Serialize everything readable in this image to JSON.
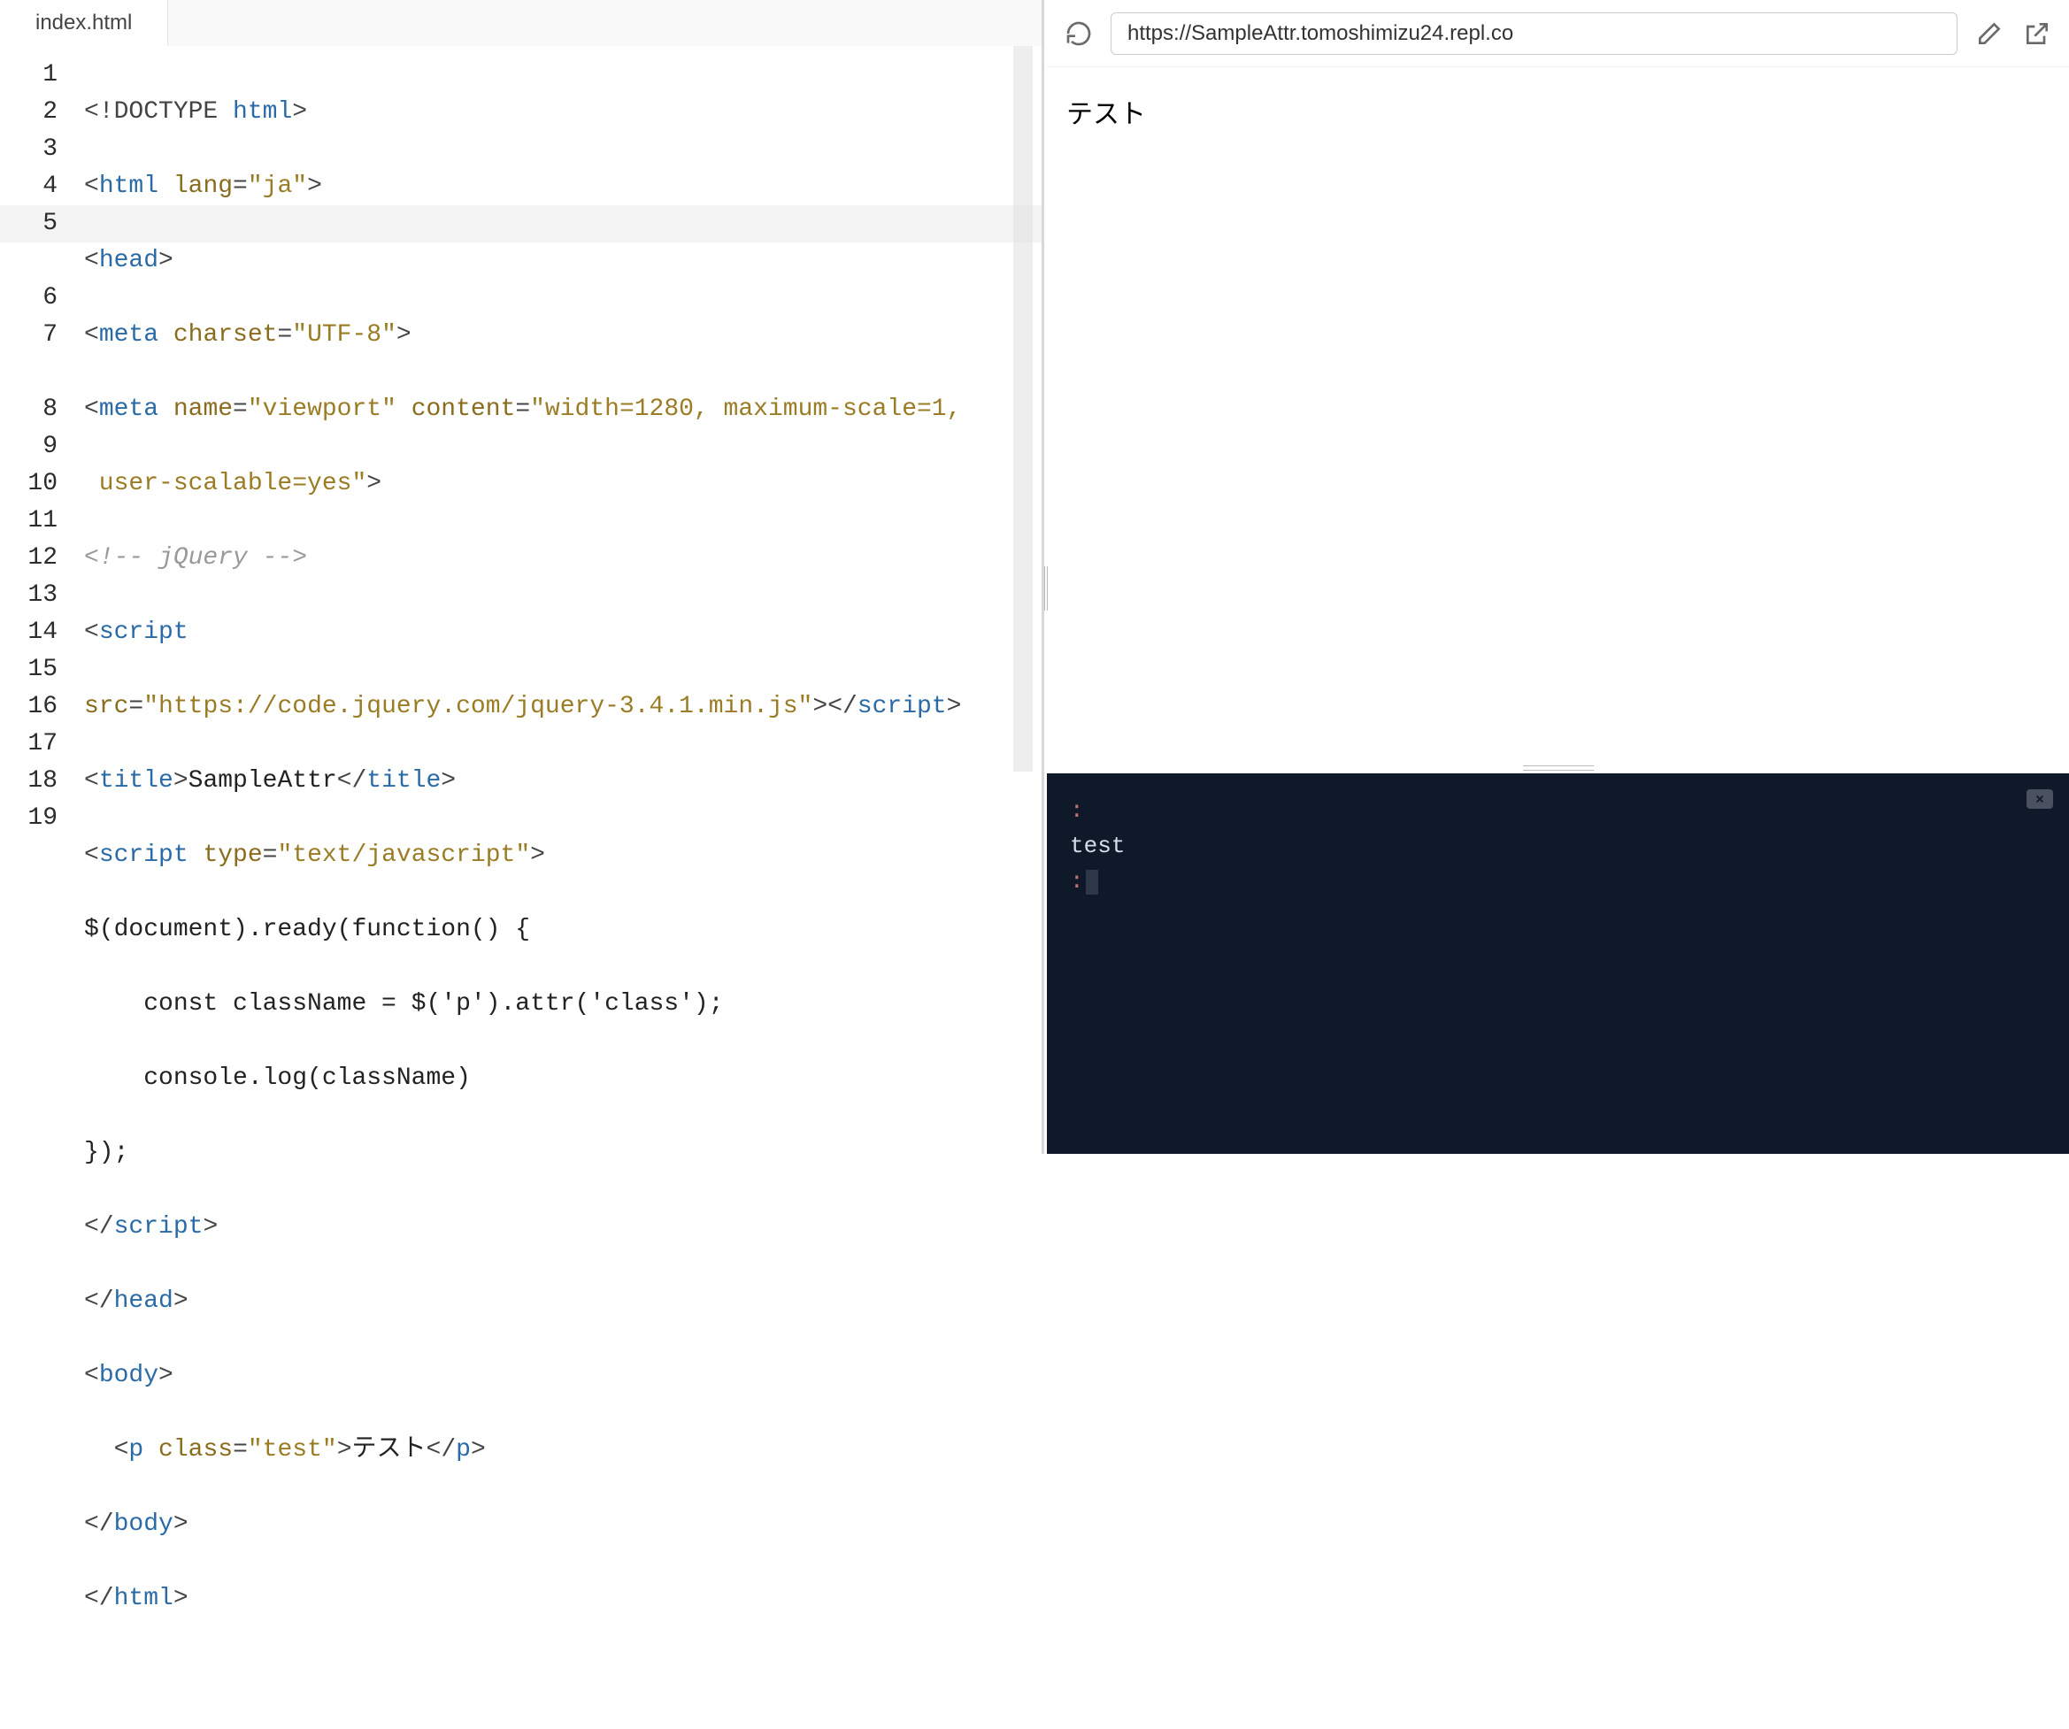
{
  "tab": {
    "filename": "index.html"
  },
  "editor": {
    "lineNumbers": [
      "1",
      "2",
      "3",
      "4",
      "5",
      "6",
      "7",
      "8",
      "9",
      "10",
      "11",
      "12",
      "13",
      "14",
      "15",
      "16",
      "17",
      "18",
      "19"
    ],
    "highlightedLine": 5,
    "code": {
      "l1": {
        "pre": "<!DOCTYPE ",
        "tag": "html",
        "post": ">"
      },
      "l2": {
        "open": "<",
        "tag": "html",
        "attrn": " lang",
        "eq": "=",
        "attrv": "\"ja\"",
        "close": ">"
      },
      "l3": {
        "open": "<",
        "tag": "head",
        "close": ">"
      },
      "l4": {
        "open": "<",
        "tag": "meta",
        "attrn": " charset",
        "eq": "=",
        "attrv": "\"UTF-8\"",
        "close": ">"
      },
      "l5": {
        "open": "<",
        "tag": "meta",
        "attrn1": " name",
        "eq1": "=",
        "attrv1": "\"viewport\"",
        "attrn2": " content",
        "eq2": "=",
        "attrv2": "\"width=1280, maximum-scale=1,"
      },
      "l5b": {
        "cont": " user-scalable=yes\"",
        "close": ">"
      },
      "l6": {
        "comment": "<!-- jQuery -->"
      },
      "l7": {
        "open": "<",
        "tag": "script"
      },
      "l7b": {
        "attrn": "src",
        "eq": "=",
        "attrv": "\"https://code.jquery.com/jquery-3.4.1.min.js\"",
        "close": ">",
        "open2": "</",
        "tag2": "script",
        "close2": ">"
      },
      "l8": {
        "open": "<",
        "tag": "title",
        "close": ">",
        "text": "SampleAttr",
        "open2": "</",
        "tag2": "title",
        "close2": ">"
      },
      "l9": {
        "open": "<",
        "tag": "script",
        "attrn": " type",
        "eq": "=",
        "attrv": "\"text/javascript\"",
        "close": ">"
      },
      "l10": {
        "text": "$(document).ready(function() {"
      },
      "l11": {
        "text": "    const className = $('p').attr('class');"
      },
      "l12": {
        "text": "    console.log(className)"
      },
      "l13": {
        "text": "});"
      },
      "l14": {
        "open": "</",
        "tag": "script",
        "close": ">"
      },
      "l15": {
        "open": "</",
        "tag": "head",
        "close": ">"
      },
      "l16": {
        "open": "<",
        "tag": "body",
        "close": ">"
      },
      "l17": {
        "open": "  <",
        "tag": "p",
        "attrn": " class",
        "eq": "=",
        "attrv": "\"test\"",
        "close": ">",
        "text": "テスト",
        "open2": "</",
        "tag2": "p",
        "close2": ">"
      },
      "l18": {
        "open": "</",
        "tag": "body",
        "close": ">"
      },
      "l19": {
        "open": "</",
        "tag": "html",
        "close": ">"
      }
    }
  },
  "browser": {
    "url": "https://SampleAttr.tomoshimizu24.repl.co",
    "previewText": "テスト"
  },
  "console": {
    "prompt": ":",
    "output": "test"
  }
}
